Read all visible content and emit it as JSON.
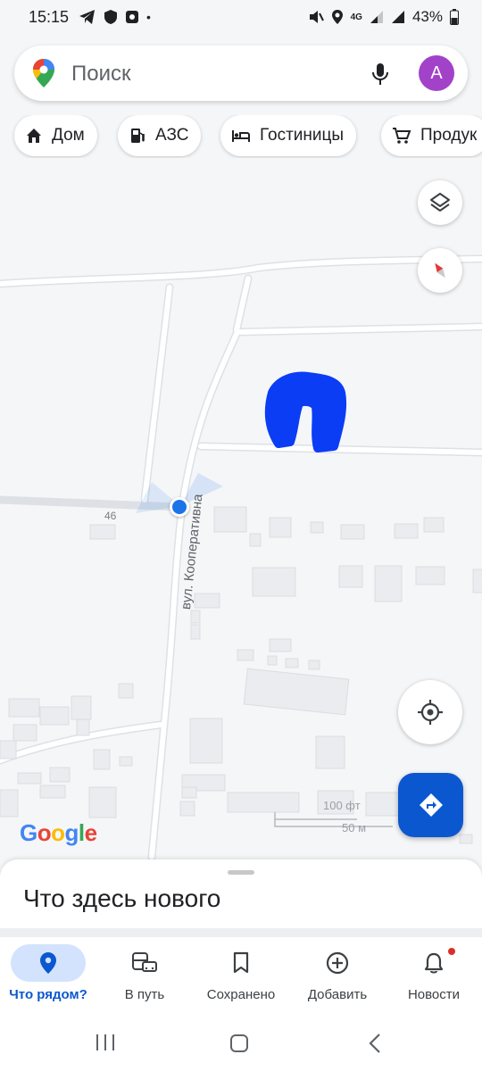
{
  "status_bar": {
    "time": "15:15",
    "network": "4G",
    "battery": "43%"
  },
  "search": {
    "placeholder": "Поиск",
    "account_initial": "A"
  },
  "chips": [
    {
      "label": "Дом",
      "icon": "home-icon"
    },
    {
      "label": "АЗС",
      "icon": "gas-station-icon"
    },
    {
      "label": "Гостиницы",
      "icon": "hotel-icon"
    },
    {
      "label": "Продук",
      "icon": "shopping-cart-icon"
    }
  ],
  "map": {
    "street_label": "вул. Кооперативна",
    "house_number": "46",
    "scale_distance": "100 фт",
    "scale_distance_alt": "50 м",
    "logo": "Google",
    "marker_color": "#1a73e8",
    "drawing_color": "#0b3df5"
  },
  "sheet": {
    "title": "Что здесь нового"
  },
  "bottom_nav": [
    {
      "label": "Что рядом?",
      "icon": "location-pin-icon",
      "active": true
    },
    {
      "label": "В путь",
      "icon": "commute-icon",
      "active": false
    },
    {
      "label": "Сохранено",
      "icon": "bookmark-icon",
      "active": false
    },
    {
      "label": "Добавить",
      "icon": "add-circle-icon",
      "active": false
    },
    {
      "label": "Новости",
      "icon": "bell-icon",
      "active": false
    }
  ]
}
